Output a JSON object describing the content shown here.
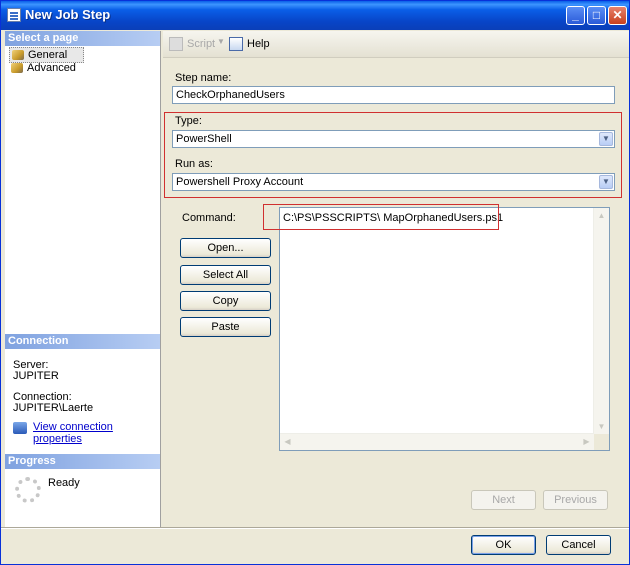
{
  "window": {
    "title": "New Job Step"
  },
  "left_pane": {
    "select_page_header": "Select a page",
    "pages": [
      {
        "label": "General"
      },
      {
        "label": "Advanced"
      }
    ],
    "connection_header": "Connection",
    "server_label": "Server:",
    "server_value": "JUPITER",
    "connection_label": "Connection:",
    "connection_value": "JUPITER\\Laerte",
    "view_connection_link": "View connection properties",
    "progress_header": "Progress",
    "progress_status": "Ready"
  },
  "toolbar": {
    "script_label": "Script",
    "help_label": "Help"
  },
  "form": {
    "step_name_label": "Step name:",
    "step_name_value": "CheckOrphanedUsers",
    "type_label": "Type:",
    "type_value": "PowerShell",
    "run_as_label": "Run as:",
    "run_as_value": "Powershell Proxy Account",
    "command_label": "Command:",
    "command_value": "C:\\PS\\PSSCRIPTS\\ MapOrphanedUsers.ps1"
  },
  "command_buttons": {
    "open": "Open...",
    "select_all": "Select All",
    "copy": "Copy",
    "paste": "Paste"
  },
  "nav_buttons": {
    "next": "Next",
    "previous": "Previous"
  },
  "dialog_buttons": {
    "ok": "OK",
    "cancel": "Cancel"
  },
  "colors": {
    "highlight_box": "#d03030",
    "title_bar": "#0a5fe8",
    "section_header": "#7fa2e0"
  },
  "icons": [
    "window-icon",
    "minimize-icon",
    "maximize-icon",
    "close-icon",
    "page-icon",
    "script-icon",
    "help-icon",
    "connection-properties-icon",
    "progress-spinner-icon"
  ]
}
